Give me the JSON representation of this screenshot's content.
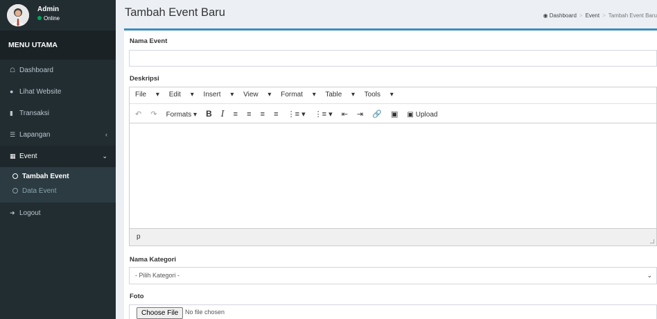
{
  "user": {
    "name": "Admin",
    "status": "Online"
  },
  "sidebar": {
    "header": "MENU UTAMA",
    "items": [
      {
        "label": "Dashboard",
        "icon": "home-icon"
      },
      {
        "label": "Lihat Website",
        "icon": "globe-icon"
      },
      {
        "label": "Transaksi",
        "icon": "book-icon"
      },
      {
        "label": "Lapangan",
        "icon": "list-icon"
      },
      {
        "label": "Event",
        "icon": "calendar-icon"
      },
      {
        "label": "Logout",
        "icon": "logout-icon"
      }
    ],
    "submenu": [
      "Tambah Event",
      "Data Event"
    ]
  },
  "header": {
    "title": "Tambah Event Baru"
  },
  "breadcrumb": [
    "Dashboard",
    "Event",
    "Tambah Event Baru"
  ],
  "form": {
    "nama_event_label": "Nama Event",
    "nama_event_value": "",
    "deskripsi_label": "Deskripsi",
    "kategori_label": "Nama Kategori",
    "kategori_selected": "- Pilih Kategori -",
    "foto_label": "Foto",
    "file_button": "Choose File",
    "file_status": "No file chosen"
  },
  "editor": {
    "menus": [
      "File",
      "Edit",
      "Insert",
      "View",
      "Format",
      "Table",
      "Tools"
    ],
    "formats_label": "Formats",
    "upload_label": "Upload",
    "status_path": "p"
  },
  "colors": {
    "sidebar": "#222d32",
    "accent": "#3c8dbc",
    "online": "#00a65a"
  }
}
